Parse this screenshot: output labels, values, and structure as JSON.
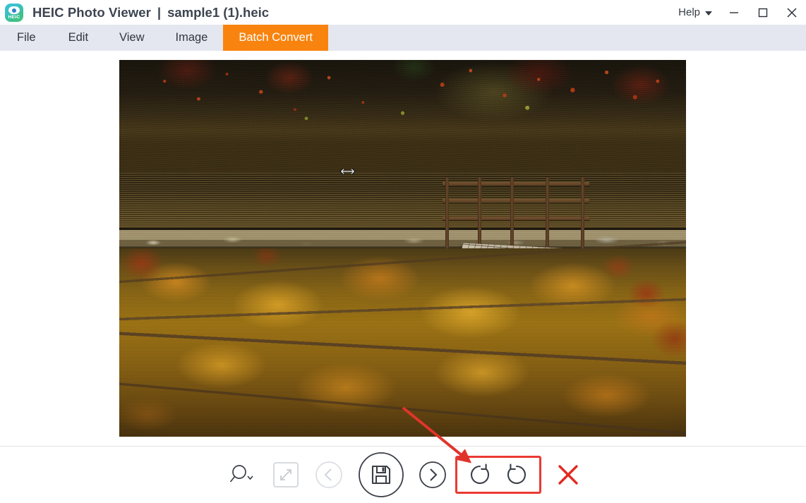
{
  "titlebar": {
    "app_icon_name": "heic-app-icon",
    "app_icon_label": "HEIC",
    "app_name": "HEIC Photo Viewer",
    "separator": "|",
    "file_name": "sample1 (1).heic",
    "help_label": "Help",
    "minimize_label": "Minimize",
    "maximize_label": "Maximize",
    "close_label": "Close"
  },
  "menubar": {
    "items": [
      {
        "label": "File",
        "active": false
      },
      {
        "label": "Edit",
        "active": false
      },
      {
        "label": "View",
        "active": false
      },
      {
        "label": "Image",
        "active": false
      },
      {
        "label": "Batch Convert",
        "active": true
      }
    ],
    "active_color": "#f8840f",
    "background": "#e4e7f0"
  },
  "viewer": {
    "photo_alt": "autumn forest foliage with water reflection and wooden shelter",
    "cursor": "horizontal-resize-cursor"
  },
  "toolbar": {
    "zoom_label": "Zoom",
    "fit_label": "Fit to window",
    "prev_label": "Previous",
    "save_label": "Save",
    "next_label": "Next",
    "rotate_left_label": "Rotate left",
    "rotate_right_label": "Rotate right",
    "close_label": "Close image",
    "prev_disabled": true,
    "fit_disabled": true,
    "close_color": "#e02b22"
  },
  "annotation": {
    "highlight_color": "#ea3a33",
    "arrow_color": "#e0342b",
    "highlight_target": "rotate-buttons"
  }
}
